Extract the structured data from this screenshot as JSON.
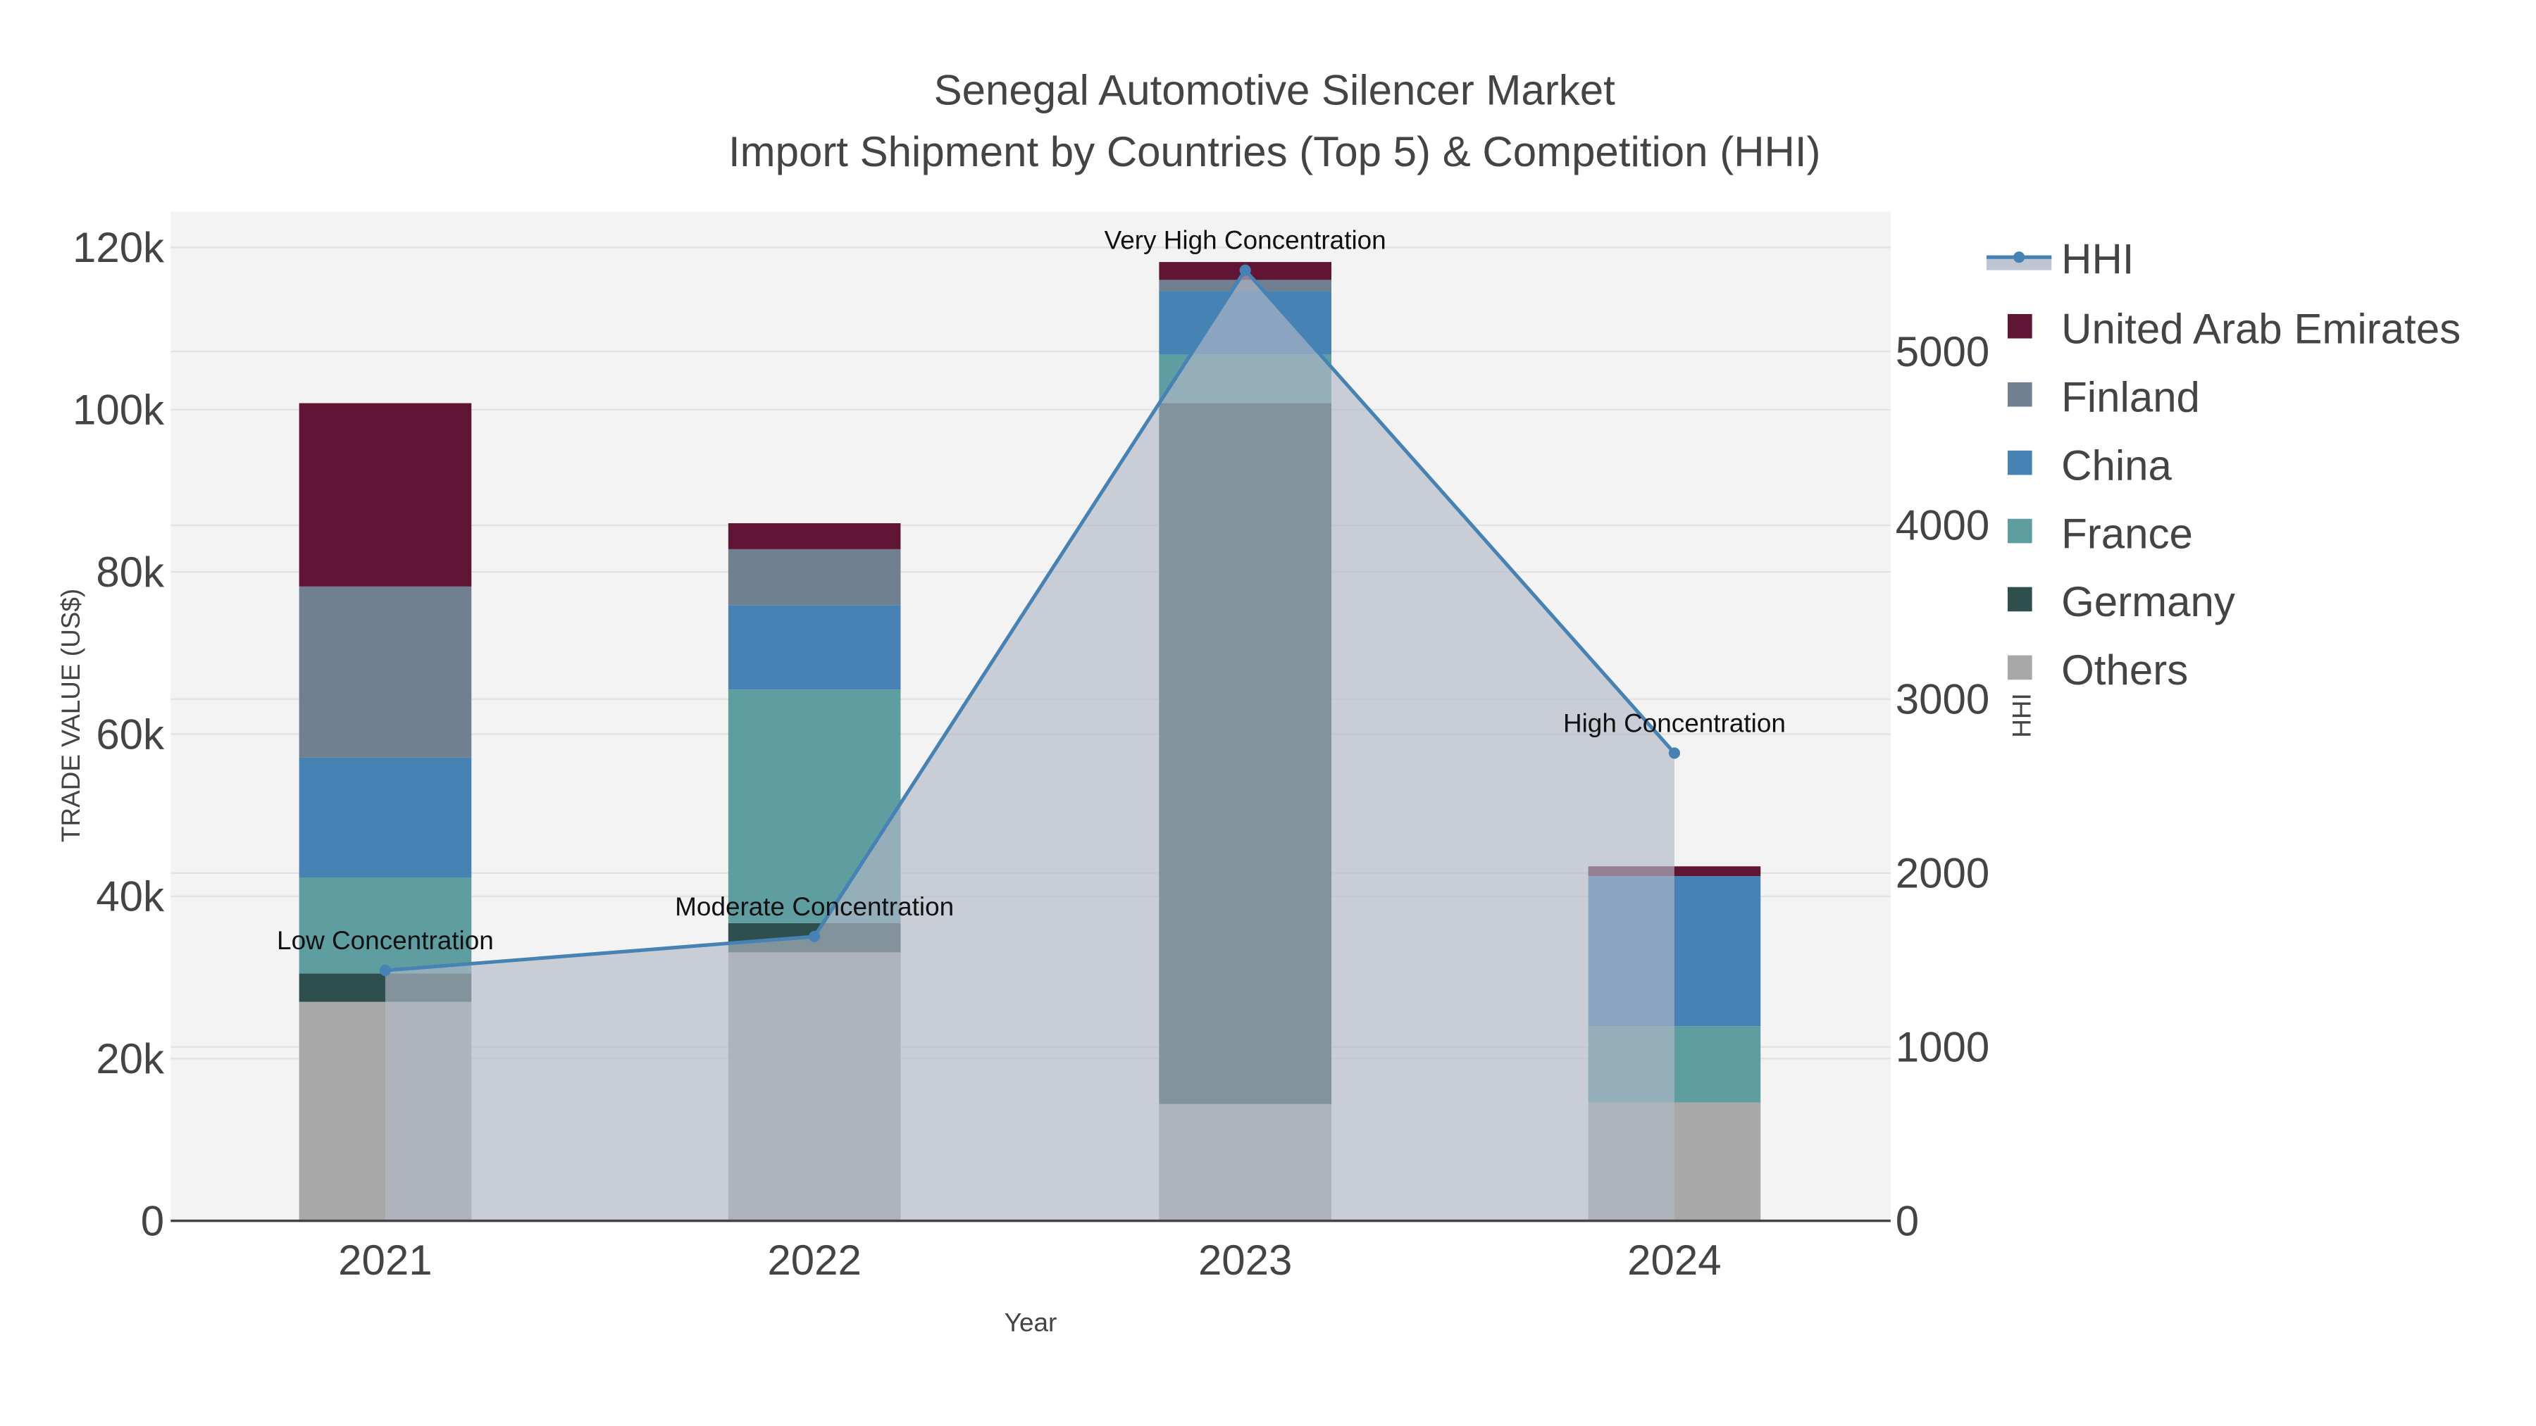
{
  "chart_data": {
    "type": "bar",
    "title": "Senegal Automotive Silencer Market",
    "subtitle": "Import Shipment by Countries (Top 5) & Competition (HHI)",
    "xlabel": "Year",
    "ylabel": "TRADE VALUE (US$)",
    "y2label": "HHI",
    "categories": [
      "2021",
      "2022",
      "2023",
      "2024"
    ],
    "ylim": [
      0,
      124000
    ],
    "y2lim": [
      0,
      5800
    ],
    "yticks": [
      {
        "v": 0,
        "label": "0"
      },
      {
        "v": 20000,
        "label": "20k"
      },
      {
        "v": 40000,
        "label": "40k"
      },
      {
        "v": 60000,
        "label": "60k"
      },
      {
        "v": 80000,
        "label": "80k"
      },
      {
        "v": 100000,
        "label": "100k"
      },
      {
        "v": 120000,
        "label": "120k"
      }
    ],
    "y2ticks": [
      {
        "v": 0,
        "label": "0"
      },
      {
        "v": 1000,
        "label": "1000"
      },
      {
        "v": 2000,
        "label": "2000"
      },
      {
        "v": 3000,
        "label": "3000"
      },
      {
        "v": 4000,
        "label": "4000"
      },
      {
        "v": 5000,
        "label": "5000"
      }
    ],
    "series": [
      {
        "name": "Others",
        "color": "#a8a8a8",
        "values": [
          27000,
          33100,
          14400,
          14600
        ]
      },
      {
        "name": "Germany",
        "color": "#2f4f4f",
        "values": [
          3500,
          3600,
          86400,
          0
        ]
      },
      {
        "name": "France",
        "color": "#5f9ea0",
        "values": [
          11800,
          28800,
          6000,
          9400
        ]
      },
      {
        "name": "China",
        "color": "#4682b4",
        "values": [
          14800,
          10400,
          7800,
          18500
        ]
      },
      {
        "name": "Finland",
        "color": "#708090",
        "values": [
          21100,
          6900,
          1400,
          0
        ]
      },
      {
        "name": "United Arab Emirates",
        "color": "#601535",
        "values": [
          22600,
          3200,
          2200,
          1200
        ]
      }
    ],
    "hhi": {
      "name": "HHI",
      "color": "#4682b4",
      "values": [
        1440,
        1635,
        5467,
        2690
      ],
      "annotations": [
        "Low Concentration",
        "Moderate Concentration",
        "Very High Concentration",
        "High Concentration"
      ]
    },
    "legend_order": [
      "HHI",
      "United Arab Emirates",
      "Finland",
      "China",
      "France",
      "Germany",
      "Others"
    ],
    "legend_placement": "top-right",
    "grid": true
  }
}
